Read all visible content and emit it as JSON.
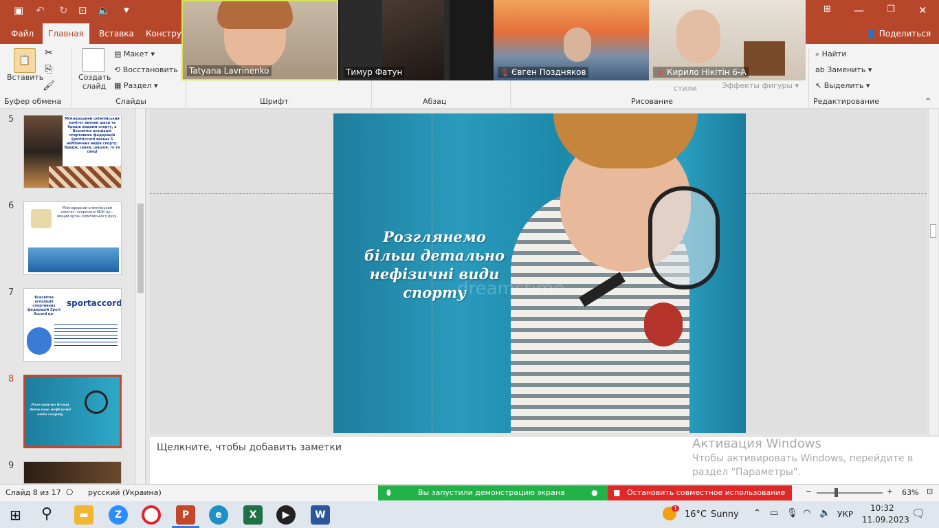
{
  "quick_access": {
    "save_icon": "save-icon",
    "undo_icon": "undo-icon",
    "redo_icon": "redo-icon"
  },
  "window_controls": {
    "restore": "▭",
    "minimize": "—",
    "maximize": "❐",
    "close": "✕"
  },
  "tabs": [
    {
      "label": "Файл"
    },
    {
      "label": "Главная"
    },
    {
      "label": "Вставка"
    },
    {
      "label": "Конструк"
    }
  ],
  "share_label": "Поделиться",
  "ribbon": {
    "paste": "Вставить",
    "clipboard_group": "Буфер обмена",
    "new_slide": "Создать слайд",
    "layout": "Макет",
    "reset": "Восстановить",
    "section": "Раздел",
    "slides_group": "Слайды",
    "font_group": "Шрифт",
    "paragraph_group": "Абзац",
    "styles": "стили",
    "shape_effects": "Эффекты фигуры",
    "drawing_group": "Рисование",
    "find": "Найти",
    "replace": "Заменить",
    "select": "Выделить",
    "editing_group": "Редактирование"
  },
  "participants": [
    {
      "name": "Tatyana Lavrinenko",
      "muted": false
    },
    {
      "name": "Тимур Фатун",
      "muted": false
    },
    {
      "name": "Євген Поздняков",
      "muted": true
    },
    {
      "name": "Кирило Нікітін 6-А",
      "muted": true
    }
  ],
  "thumbnails": [
    {
      "num": "5",
      "text": "Міжнародний олімпійський комітет визнав шахи та бридж видами спорту, а Всесвітня асоціація спортивних федерацій SportAccord визнає 5 неМізичних видів спорту: бридж, шахи, шашки, го та сянці"
    },
    {
      "num": "6",
      "text": "Міжнародний олімпійський комітет, скорочено МОК це— вищий орган олімпійського руху."
    },
    {
      "num": "7",
      "text": "Всесвітня асоціація спортивних федерацій Sport Accord це-",
      "logo": "sportaccord"
    },
    {
      "num": "8",
      "text": "Розглянемо більш детально нефізичні види спорту"
    },
    {
      "num": "9",
      "text": ""
    }
  ],
  "slide": {
    "title": "Розглянемо більш детально нефізичні види спорту",
    "watermark": "dreamstime"
  },
  "notes_placeholder": "Щелкните, чтобы добавить заметки",
  "activation": {
    "title": "Активация Windows",
    "line1": "Чтобы активировать Windows, перейдите в",
    "line2": "раздел \"Параметры\"."
  },
  "status": {
    "slide_info": "Слайд 8 из 17",
    "language": "русский (Украина)",
    "share_notice": "Вы запустили демонстрацию экрана",
    "stop_share": "Остановить совместное использование",
    "zoom": "63%"
  },
  "taskbar": {
    "weather_temp": "16°C",
    "weather_text": "Sunny",
    "lang": "УКР",
    "time": "10:32",
    "date": "11.09.2023",
    "notify_badge": "1"
  }
}
